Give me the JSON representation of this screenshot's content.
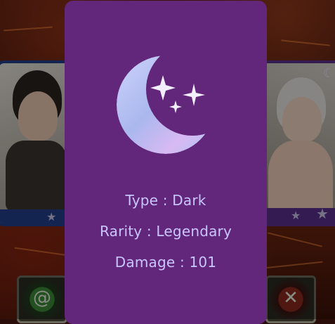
{
  "card": {
    "element_icon": "crescent-moon-sparkles-icon",
    "type_label": "Type",
    "type_value": "Dark",
    "rarity_label": "Rarity",
    "rarity_value": "Legendary",
    "damage_label": "Damage",
    "damage_value": "101",
    "separator": ":"
  },
  "background_cards": {
    "left": {
      "border_color": "#243f8c",
      "icon": "star-icon"
    },
    "right": {
      "border_color": "#5a2f8e",
      "icon": "crescent-moon-icon"
    }
  },
  "buttons": {
    "left_icon": "swirl-icon",
    "right_icon": "crossed-swords-icon"
  },
  "colors": {
    "card_background": "#62267a",
    "card_text": "#c9c6ff"
  }
}
